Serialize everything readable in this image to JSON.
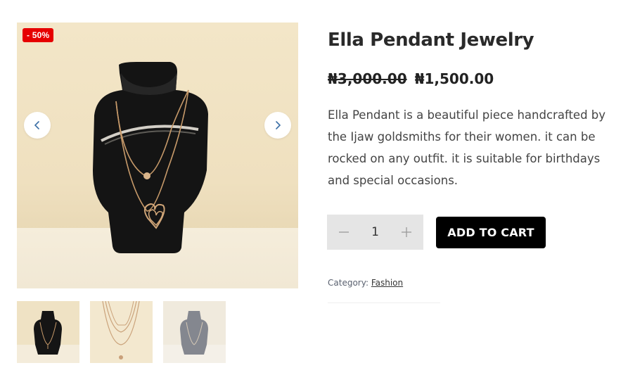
{
  "gallery": {
    "sale_badge": "- 50%",
    "prev_icon": "chevron-left-icon",
    "next_icon": "chevron-right-icon",
    "thumbnails": [
      "thumbnail-1",
      "thumbnail-2",
      "thumbnail-3"
    ]
  },
  "product": {
    "title": "Ella Pendant Jewelry",
    "price_old": "₦3,000.00",
    "price_new": "₦1,500.00",
    "description": "Ella Pendant is a beautiful piece handcrafted by the Ijaw goldsmiths for their women. it can be rocked on any outfit. it is suitable for birthdays and special occasions."
  },
  "cart": {
    "quantity": "1",
    "minus_icon": "minus-icon",
    "plus_icon": "plus-icon",
    "add_label": "ADD TO CART"
  },
  "meta": {
    "category_label": "Category:",
    "category_value": "Fashion"
  },
  "colors": {
    "sale": "#e60000",
    "button": "#000000",
    "qty_bg": "#e5e5e5",
    "arrow": "#3a6ea5"
  }
}
